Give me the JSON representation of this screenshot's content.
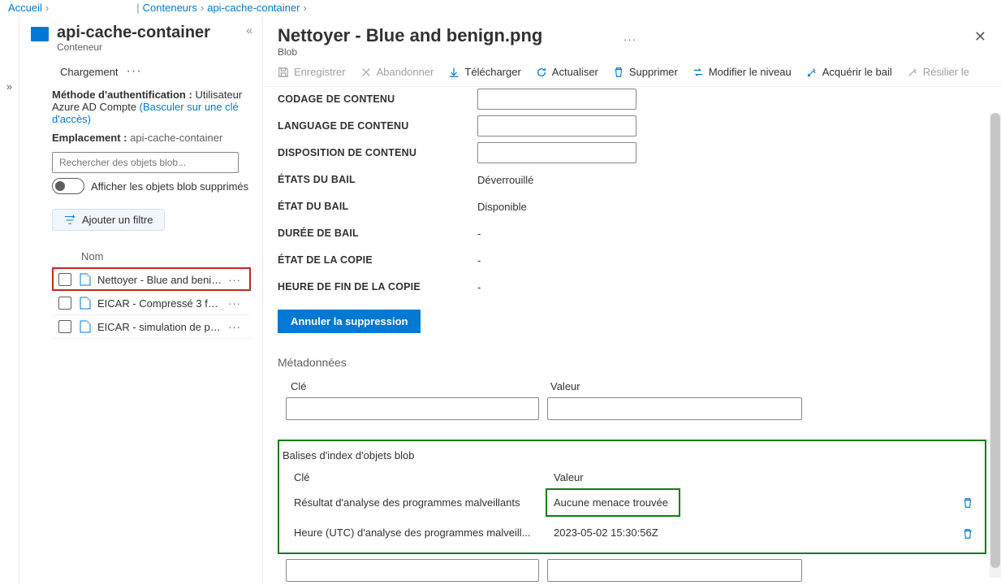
{
  "breadcrumb": {
    "home": "Accueil",
    "containers": "Conteneurs",
    "container": "api-cache-container"
  },
  "left": {
    "title": "api-cache-container",
    "subtitle": "Conteneur",
    "upload": "Chargement",
    "auth_label": "Méthode d'authentification :",
    "auth_value": "Utilisateur Azure AD Compte",
    "auth_switch": "(Basculer sur une clé d'accès)",
    "loc_label": "Emplacement :",
    "loc_value": "api-cache-container",
    "search_placeholder": "Rechercher des objets blob...",
    "show_deleted": "Afficher les objets blob supprimés",
    "add_filter": "Ajouter un filtre",
    "col_name": "Nom",
    "items": [
      {
        "name": "Nettoyer - Blue and benign..."
      },
      {
        "name": "EICAR - Compressé 3 fois..."
      },
      {
        "name": "EICAR - simulation de progr..."
      }
    ]
  },
  "right": {
    "title": "Nettoyer - Blue and benign.png",
    "subtitle": "Blob",
    "cmds": {
      "save": "Enregistrer",
      "discard": "Abandonner",
      "download": "Télécharger",
      "refresh": "Actualiser",
      "delete": "Supprimer",
      "changetier": "Modifier le niveau",
      "acquire": "Acquérir le bail",
      "release": "Résilier le"
    },
    "props": {
      "encoding": "CODAGE DE CONTENU",
      "language": "LANGUAGE DE CONTENU",
      "disposition": "DISPOSITION DE CONTENU",
      "lease_states": "ÉTATS DU BAIL",
      "lease_states_v": "Déverrouillé",
      "lease_state": "ÉTAT DU BAIL",
      "lease_state_v": "Disponible",
      "lease_duration": "DURÉE DE BAIL",
      "lease_duration_v": "-",
      "copy_state": "ÉTAT DE LA COPIE",
      "copy_state_v": "-",
      "copy_end": "HEURE DE FIN DE LA COPIE",
      "copy_end_v": "-"
    },
    "undo": "Annuler la suppression",
    "metadata": "Métadonnées",
    "key_label": "Clé",
    "value_label": "Valeur",
    "indextags_title": "Balises d'index d'objets blob",
    "tags": [
      {
        "k": "Résultat d'analyse des programmes malveillants",
        "v": "Aucune menace trouvée"
      },
      {
        "k": "Heure (UTC) d'analyse des programmes malveill...",
        "v": "2023-05-02 15:30:56Z"
      }
    ]
  }
}
